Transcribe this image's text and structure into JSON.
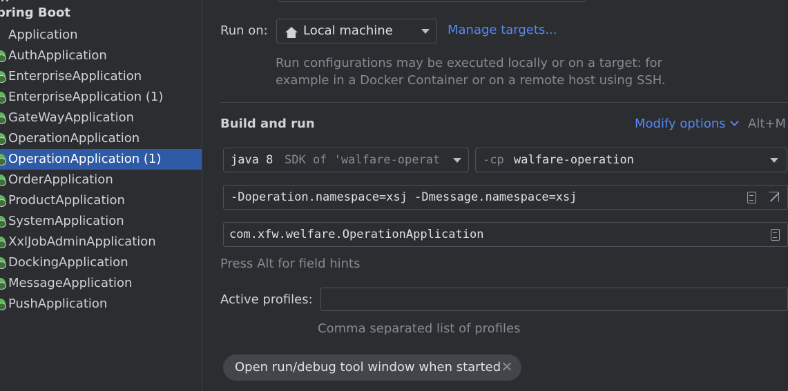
{
  "sidebar": {
    "group_title": "pring Boot",
    "items": [
      {
        "label": "Application",
        "icon": "none"
      },
      {
        "label": "AuthApplication",
        "icon": "spring-boot-icon"
      },
      {
        "label": "EnterpriseApplication",
        "icon": "spring-boot-icon"
      },
      {
        "label": "EnterpriseApplication (1)",
        "icon": "spring-boot-icon"
      },
      {
        "label": "GateWayApplication",
        "icon": "spring-boot-icon"
      },
      {
        "label": "OperationApplication",
        "icon": "spring-boot-icon"
      },
      {
        "label": "OperationApplication (1)",
        "icon": "spring-boot-icon",
        "selected": true
      },
      {
        "label": "OrderApplication",
        "icon": "spring-boot-icon"
      },
      {
        "label": "ProductApplication",
        "icon": "spring-boot-icon"
      },
      {
        "label": "SystemApplication",
        "icon": "spring-boot-icon"
      },
      {
        "label": "XxlJobAdminApplication",
        "icon": "spring-boot-icon"
      },
      {
        "label": "DockingApplication",
        "icon": "spring-boot-icon"
      },
      {
        "label": "MessageApplication",
        "icon": "spring-boot-icon"
      },
      {
        "label": "PushApplication",
        "icon": "spring-boot-icon"
      }
    ]
  },
  "run_on": {
    "label": "Run on:",
    "value": "Local machine",
    "manage_link": "Manage targets...",
    "hint_line1": "Run configurations may be executed locally or on a target: for",
    "hint_line2": "example in a Docker Container or on a remote host using SSH."
  },
  "build_run": {
    "title": "Build and run",
    "modify_options": "Modify options",
    "modify_shortcut": "Alt+M",
    "jdk_prefix": "java 8",
    "jdk_detail": "SDK of 'walfare-operat",
    "cp_prefix": "-cp",
    "cp_value": "walfare-operation",
    "vm_options": "-Doperation.namespace=xsj -Dmessage.namespace=xsj",
    "main_class": "com.xfw.welfare.OperationApplication",
    "field_hint": "Press Alt for field hints"
  },
  "profiles": {
    "label": "Active profiles:",
    "value": "",
    "hint": "Comma separated list of profiles"
  },
  "chip": {
    "label": "Open run/debug tool window when started"
  },
  "colors": {
    "background": "#2b2d30",
    "selection": "#2e5aa6",
    "link": "#548af7",
    "hint": "#868a91"
  }
}
